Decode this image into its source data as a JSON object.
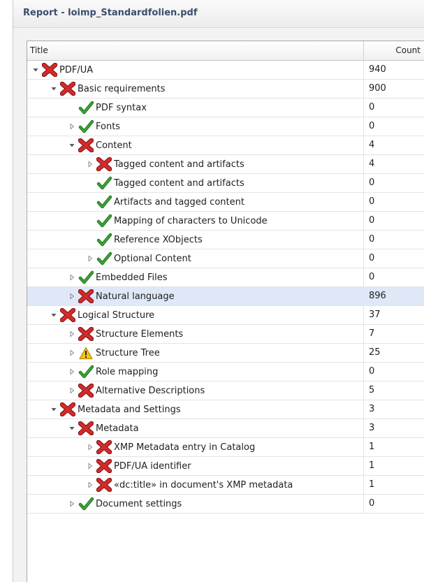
{
  "window": {
    "title": "Report - loimp_Standardfolien.pdf"
  },
  "grid": {
    "columns": {
      "title": "Title",
      "count": "Count"
    },
    "rows": [
      {
        "label": "PDF/UA",
        "count": "940",
        "status": "fail",
        "level": 0,
        "expander": "expanded",
        "selected": false
      },
      {
        "label": "Basic requirements",
        "count": "900",
        "status": "fail",
        "level": 1,
        "expander": "expanded",
        "selected": false
      },
      {
        "label": "PDF syntax",
        "count": "0",
        "status": "pass",
        "level": 2,
        "expander": "none",
        "selected": false
      },
      {
        "label": "Fonts",
        "count": "0",
        "status": "pass",
        "level": 2,
        "expander": "collapsed",
        "selected": false
      },
      {
        "label": "Content",
        "count": "4",
        "status": "fail",
        "level": 2,
        "expander": "expanded",
        "selected": false
      },
      {
        "label": "Tagged content and artifacts",
        "count": "4",
        "status": "fail",
        "level": 3,
        "expander": "collapsed",
        "selected": false
      },
      {
        "label": "Tagged content and artifacts",
        "count": "0",
        "status": "pass",
        "level": 3,
        "expander": "none",
        "selected": false
      },
      {
        "label": "Artifacts and tagged content",
        "count": "0",
        "status": "pass",
        "level": 3,
        "expander": "none",
        "selected": false
      },
      {
        "label": "Mapping of characters to Unicode",
        "count": "0",
        "status": "pass",
        "level": 3,
        "expander": "none",
        "selected": false
      },
      {
        "label": "Reference XObjects",
        "count": "0",
        "status": "pass",
        "level": 3,
        "expander": "none",
        "selected": false
      },
      {
        "label": "Optional Content",
        "count": "0",
        "status": "pass",
        "level": 3,
        "expander": "collapsed",
        "selected": false
      },
      {
        "label": "Embedded Files",
        "count": "0",
        "status": "pass",
        "level": 2,
        "expander": "collapsed",
        "selected": false
      },
      {
        "label": "Natural language",
        "count": "896",
        "status": "fail",
        "level": 2,
        "expander": "collapsed",
        "selected": true
      },
      {
        "label": "Logical Structure",
        "count": "37",
        "status": "fail",
        "level": 1,
        "expander": "expanded",
        "selected": false
      },
      {
        "label": "Structure Elements",
        "count": "7",
        "status": "fail",
        "level": 2,
        "expander": "collapsed",
        "selected": false
      },
      {
        "label": "Structure Tree",
        "count": "25",
        "status": "warn",
        "level": 2,
        "expander": "collapsed",
        "selected": false
      },
      {
        "label": "Role mapping",
        "count": "0",
        "status": "pass",
        "level": 2,
        "expander": "collapsed",
        "selected": false
      },
      {
        "label": "Alternative Descriptions",
        "count": "5",
        "status": "fail",
        "level": 2,
        "expander": "collapsed",
        "selected": false
      },
      {
        "label": "Metadata and Settings",
        "count": "3",
        "status": "fail",
        "level": 1,
        "expander": "expanded",
        "selected": false
      },
      {
        "label": "Metadata",
        "count": "3",
        "status": "fail",
        "level": 2,
        "expander": "expanded",
        "selected": false
      },
      {
        "label": "XMP Metadata entry in Catalog",
        "count": "1",
        "status": "fail",
        "level": 3,
        "expander": "collapsed",
        "selected": false
      },
      {
        "label": "PDF/UA identifier",
        "count": "1",
        "status": "fail",
        "level": 3,
        "expander": "collapsed",
        "selected": false
      },
      {
        "label": "«dc:title» in document's XMP metadata",
        "count": "1",
        "status": "fail",
        "level": 3,
        "expander": "collapsed",
        "selected": false
      },
      {
        "label": "Document settings",
        "count": "0",
        "status": "pass",
        "level": 2,
        "expander": "collapsed",
        "selected": false
      }
    ]
  },
  "icons": {
    "fail": "red-x-icon",
    "pass": "green-check-icon",
    "warn": "warning-triangle-icon",
    "expanded": "expanded-arrow-icon",
    "collapsed": "collapsed-arrow-icon"
  },
  "colors": {
    "fail": "#d42a2a",
    "pass": "#3aa336",
    "warn": "#f2c418",
    "selected_row": "#dfe8f7",
    "title_text": "#3c4e6e"
  }
}
